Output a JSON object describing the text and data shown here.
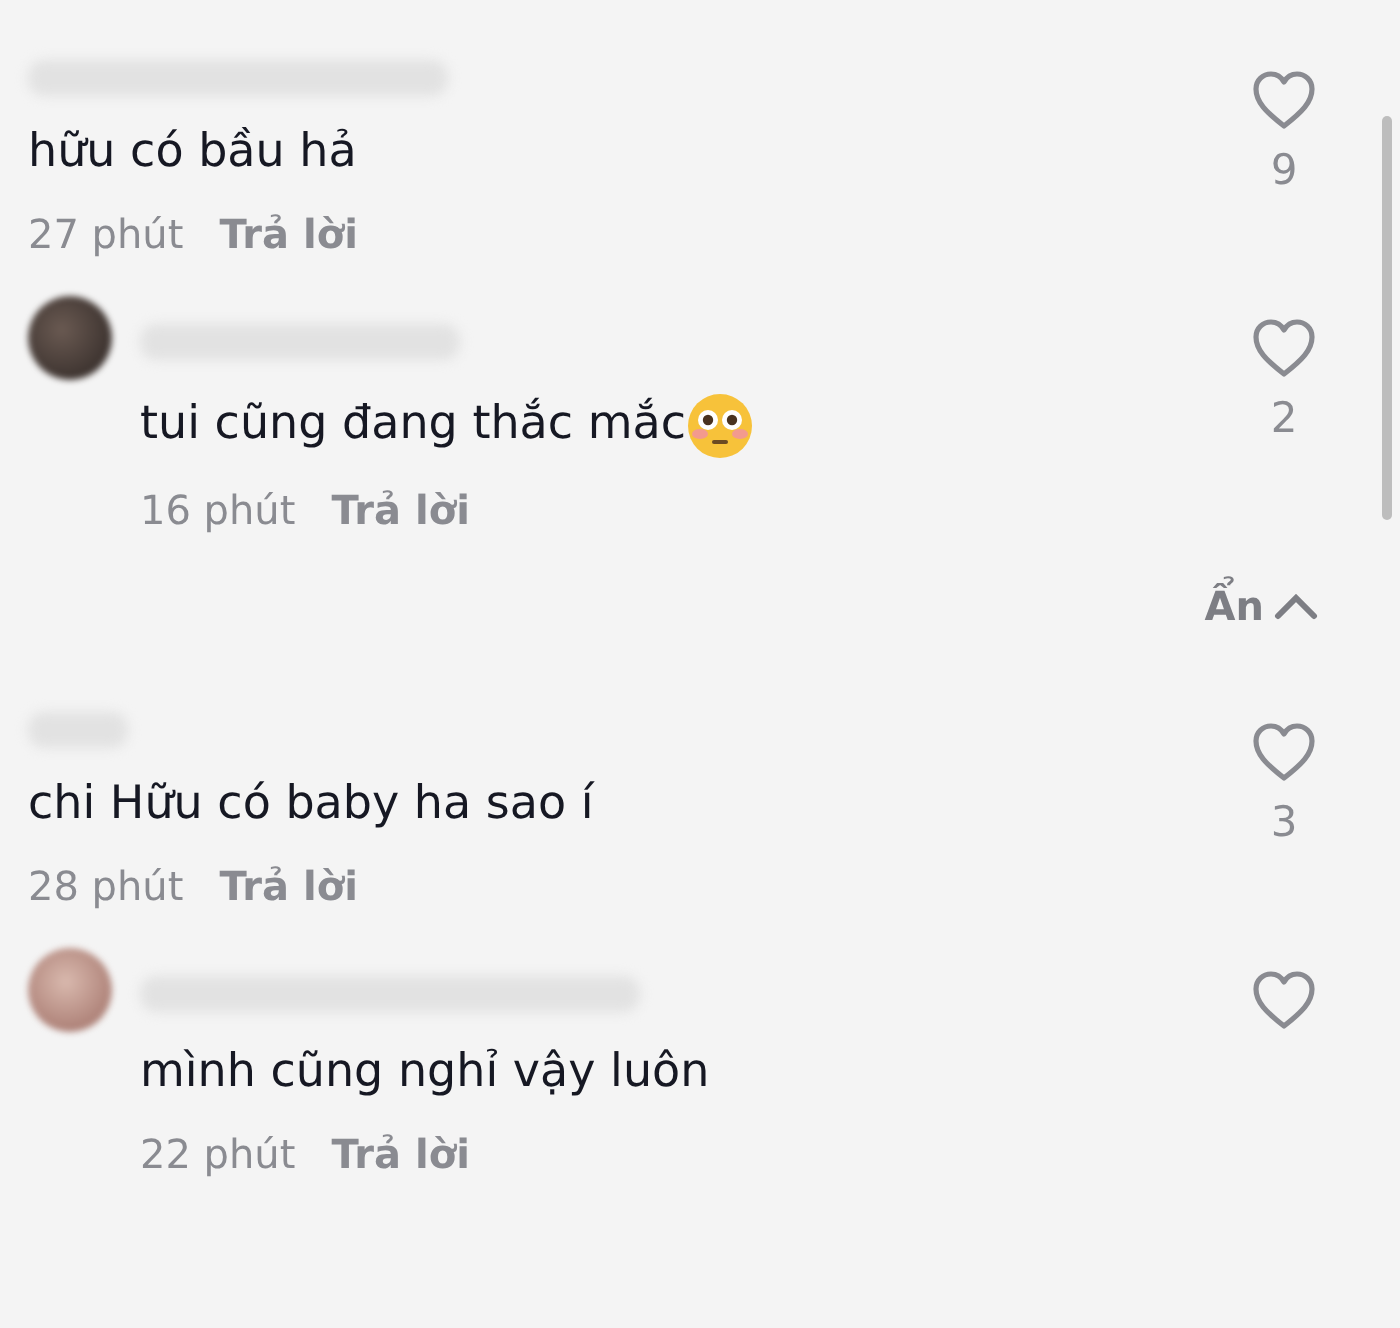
{
  "comments": [
    {
      "kind": "comment",
      "text": "hữu có bầu hả",
      "emoji": false,
      "time": "27 phút",
      "reply_label": "Trả lời",
      "likes": "9"
    },
    {
      "kind": "reply",
      "text": "tui cũng đang thắc mắc",
      "emoji": true,
      "time": "16 phút",
      "reply_label": "Trả lời",
      "likes": "2"
    },
    {
      "kind": "hide",
      "label": "Ẩn"
    },
    {
      "kind": "comment",
      "text": "chi Hữu có baby ha sao í",
      "emoji": false,
      "time": "28 phút",
      "reply_label": "Trả lời",
      "likes": "3"
    },
    {
      "kind": "reply",
      "text": "mình cũng nghỉ vậy luôn",
      "emoji": false,
      "time": "22 phút",
      "reply_label": "Trả lời"
    }
  ]
}
